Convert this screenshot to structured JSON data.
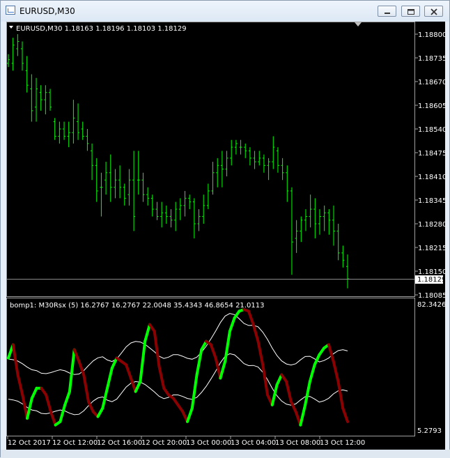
{
  "window": {
    "title": "EURUSD,M30",
    "minimize_icon": "minimize-icon",
    "restore_icon": "restore-icon",
    "close_icon": "close-icon"
  },
  "main_chart": {
    "header": "EURUSD,M30  1.18163 1.18196 1.18103 1.18129",
    "price_labels": [
      "1.18800",
      "1.18735",
      "1.18670",
      "1.18605",
      "1.18540",
      "1.18475",
      "1.18410",
      "1.18345",
      "1.18280",
      "1.18215",
      "1.18150",
      "1.18085"
    ],
    "current_price": "1.18129"
  },
  "indicator": {
    "header": "bomp1: M30Rsx (5) 16.2767 16.2767 22.0048 35.4343 46.8654 21.0113",
    "max_label": "82.3426",
    "min_label": "5.2793"
  },
  "time_axis": {
    "labels": [
      "12 Oct 2017",
      "12 Oct 12:00",
      "12 Oct 16:00",
      "12 Oct 20:00",
      "13 Oct 00:00",
      "13 Oct 04:00",
      "13 Oct 08:00",
      "13 Oct 12:00"
    ]
  },
  "colors": {
    "background": "#000000",
    "bars": "#00ff00",
    "rsx_up": "#00ff00",
    "rsx_down": "#8b0000",
    "bands": "#ffffff"
  },
  "chart_data": {
    "type": "bar",
    "title": "EURUSD,M30",
    "ylim": [
      1.18085,
      1.188
    ],
    "ohlc_bars": [
      [
        1.1872,
        1.18745,
        1.1871,
        1.1873
      ],
      [
        1.1872,
        1.1879,
        1.187,
        1.1877
      ],
      [
        1.1876,
        1.188,
        1.1874,
        1.1878
      ],
      [
        1.1876,
        1.1878,
        1.187,
        1.1872
      ],
      [
        1.187,
        1.1874,
        1.1864,
        1.1866
      ],
      [
        1.1865,
        1.1869,
        1.1856,
        1.1859
      ],
      [
        1.186,
        1.1868,
        1.1856,
        1.1865
      ],
      [
        1.1864,
        1.1866,
        1.1859,
        1.1862
      ],
      [
        1.1862,
        1.1866,
        1.1858,
        1.1864
      ],
      [
        1.1864,
        1.1865,
        1.1859,
        1.186
      ],
      [
        1.1856,
        1.1857,
        1.1851,
        1.1852
      ],
      [
        1.1852,
        1.1856,
        1.185,
        1.1854
      ],
      [
        1.1854,
        1.1856,
        1.1851,
        1.1852
      ],
      [
        1.1852,
        1.1856,
        1.1849,
        1.1853
      ],
      [
        1.1853,
        1.1862,
        1.185,
        1.1857
      ],
      [
        1.1856,
        1.1861,
        1.1851,
        1.1853
      ],
      [
        1.1854,
        1.1856,
        1.1851,
        1.1852
      ],
      [
        1.1852,
        1.1854,
        1.1848,
        1.185
      ],
      [
        1.1848,
        1.185,
        1.184,
        1.1844
      ],
      [
        1.1844,
        1.1846,
        1.1834,
        1.1837
      ],
      [
        1.1838,
        1.1842,
        1.183,
        1.1838
      ],
      [
        1.184,
        1.1845,
        1.1836,
        1.1842
      ],
      [
        1.1842,
        1.1847,
        1.1834,
        1.1838
      ],
      [
        1.1838,
        1.1843,
        1.1835,
        1.184
      ],
      [
        1.184,
        1.1844,
        1.1835,
        1.1838
      ],
      [
        1.1838,
        1.1839,
        1.1833,
        1.1835
      ],
      [
        1.1836,
        1.1843,
        1.1833,
        1.184
      ],
      [
        1.184,
        1.1848,
        1.1826,
        1.183
      ],
      [
        1.184,
        1.1848,
        1.1836,
        1.184
      ],
      [
        1.184,
        1.1842,
        1.1834,
        1.1836
      ],
      [
        1.1836,
        1.1838,
        1.1833,
        1.1835
      ],
      [
        1.1835,
        1.1836,
        1.183,
        1.1832
      ],
      [
        1.1832,
        1.1834,
        1.1829,
        1.183
      ],
      [
        1.183,
        1.1834,
        1.1827,
        1.1831
      ],
      [
        1.1831,
        1.1833,
        1.1828,
        1.183
      ],
      [
        1.183,
        1.1832,
        1.1827,
        1.1829
      ],
      [
        1.1829,
        1.1834,
        1.1826,
        1.1832
      ],
      [
        1.1832,
        1.1835,
        1.1829,
        1.1833
      ],
      [
        1.1833,
        1.1837,
        1.183,
        1.1835
      ],
      [
        1.1835,
        1.1836,
        1.1832,
        1.1834
      ],
      [
        1.1834,
        1.1835,
        1.1824,
        1.1828
      ],
      [
        1.1828,
        1.1832,
        1.1826,
        1.183
      ],
      [
        1.183,
        1.1836,
        1.1828,
        1.1833
      ],
      [
        1.1833,
        1.1839,
        1.1832,
        1.1837
      ],
      [
        1.1837,
        1.1845,
        1.1836,
        1.1842
      ],
      [
        1.1842,
        1.1846,
        1.1838,
        1.1844
      ],
      [
        1.1844,
        1.1848,
        1.1838,
        1.1843
      ],
      [
        1.1843,
        1.1848,
        1.1841,
        1.1846
      ],
      [
        1.1846,
        1.1851,
        1.1844,
        1.1849
      ],
      [
        1.1849,
        1.1851,
        1.1847,
        1.185
      ],
      [
        1.1849,
        1.1851,
        1.1847,
        1.1849
      ],
      [
        1.1849,
        1.185,
        1.1846,
        1.1848
      ],
      [
        1.1848,
        1.1849,
        1.1844,
        1.1846
      ],
      [
        1.1846,
        1.1848,
        1.1843,
        1.1845
      ],
      [
        1.1845,
        1.1848,
        1.1844,
        1.1846
      ],
      [
        1.1846,
        1.1847,
        1.1842,
        1.1844
      ],
      [
        1.1844,
        1.1846,
        1.184,
        1.1845
      ],
      [
        1.1845,
        1.1852,
        1.1843,
        1.1849
      ],
      [
        1.1848,
        1.1849,
        1.1842,
        1.1844
      ],
      [
        1.1844,
        1.1846,
        1.184,
        1.1842
      ],
      [
        1.1842,
        1.1844,
        1.1834,
        1.1837
      ],
      [
        1.1837,
        1.1838,
        1.1814,
        1.1823
      ],
      [
        1.1824,
        1.1829,
        1.182,
        1.1826
      ],
      [
        1.1826,
        1.183,
        1.1823,
        1.1829
      ],
      [
        1.1829,
        1.1832,
        1.1826,
        1.183
      ],
      [
        1.183,
        1.1836,
        1.1827,
        1.1832
      ],
      [
        1.1832,
        1.1835,
        1.1824,
        1.1828
      ],
      [
        1.1828,
        1.1832,
        1.1825,
        1.183
      ],
      [
        1.183,
        1.1833,
        1.1826,
        1.1831
      ],
      [
        1.1831,
        1.1832,
        1.1825,
        1.1829
      ],
      [
        1.1829,
        1.1833,
        1.1822,
        1.1826
      ],
      [
        1.1826,
        1.1828,
        1.1818,
        1.182
      ],
      [
        1.182,
        1.1822,
        1.1816,
        1.1818
      ],
      [
        1.18163,
        1.18196,
        1.18103,
        1.18129
      ]
    ],
    "rsx": {
      "ylim": [
        5.2793,
        82.3426
      ],
      "values": [
        50,
        58,
        40,
        28,
        14,
        26,
        32,
        32,
        28,
        18,
        10,
        12,
        22,
        30,
        55,
        48,
        40,
        24,
        18,
        15,
        20,
        32,
        44,
        50,
        48,
        46,
        38,
        30,
        36,
        60,
        70,
        66,
        45,
        32,
        28,
        26,
        22,
        18,
        12,
        20,
        40,
        55,
        60,
        58,
        50,
        38,
        48,
        66,
        74,
        78,
        79,
        78,
        70,
        60,
        46,
        28,
        22,
        34,
        40,
        36,
        24,
        18,
        10,
        22,
        36,
        46,
        52,
        56,
        58,
        48,
        36,
        20,
        12
      ]
    }
  }
}
